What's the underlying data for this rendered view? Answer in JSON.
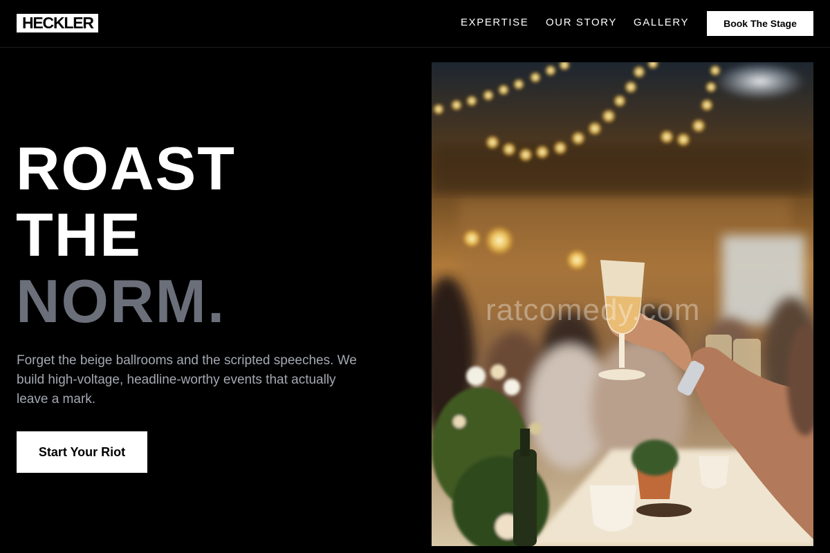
{
  "header": {
    "logo": "HECKLER",
    "nav": [
      "EXPERTISE",
      "OUR STORY",
      "GALLERY"
    ],
    "cta": "Book The Stage"
  },
  "hero": {
    "headline": [
      "ROAST",
      "THE",
      "NORM."
    ],
    "subtitle": "Forget the beige ballrooms and the scripted speeches. We build high-voltage, headline-worthy events that actually leave a mark.",
    "cta": "Start Your Riot"
  },
  "photo": {
    "subject": "event-celebration-toast-photo",
    "watermark": "ratcomedy.com"
  },
  "colors": {
    "background": "#000000",
    "text": "#ffffff",
    "muted_headline": "#6b6f7a",
    "subtitle": "#a4a8b2"
  }
}
